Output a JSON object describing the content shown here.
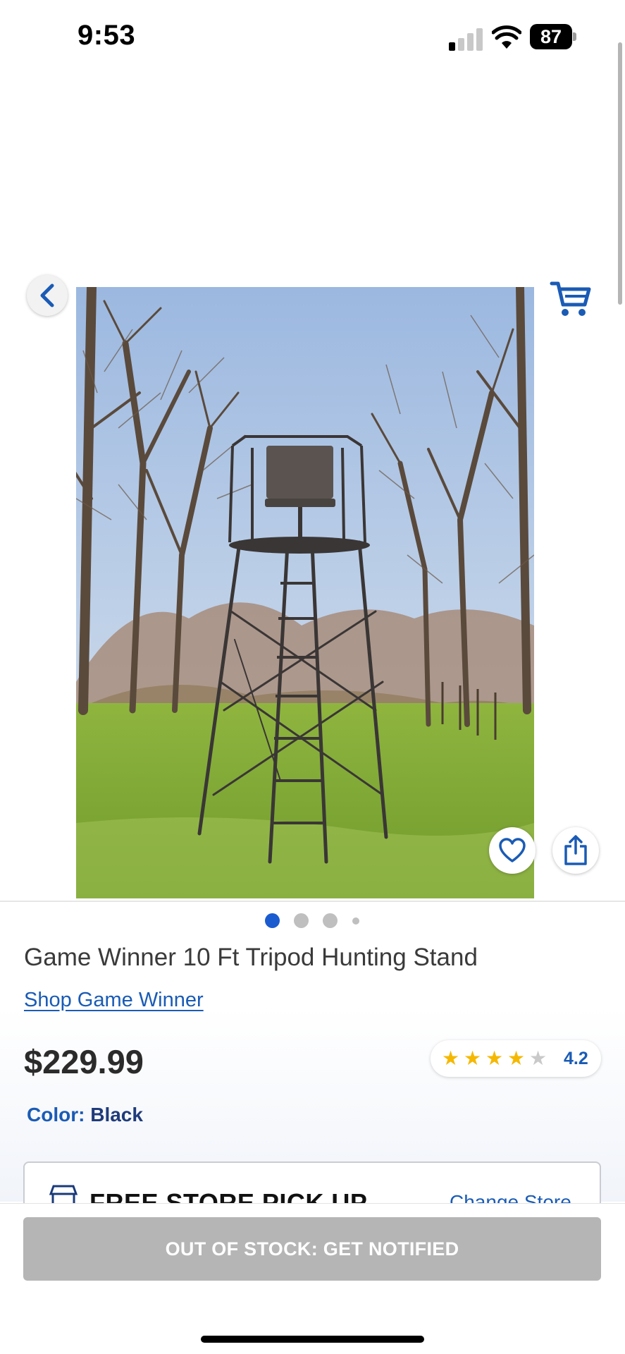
{
  "status_bar": {
    "time": "9:53",
    "battery": "87",
    "icons": [
      "signal-icon",
      "wifi-icon",
      "battery-icon"
    ]
  },
  "header": {
    "icons": [
      "chevron-left-icon",
      "cart-icon"
    ]
  },
  "gallery": {
    "image_count": 4,
    "active_index": 0,
    "actions": [
      "heart-icon",
      "share-icon"
    ]
  },
  "product": {
    "title": "Game Winner 10 Ft Tripod Hunting Stand",
    "brand_link": "Shop Game Winner",
    "price": "$229.99",
    "rating": "4.2",
    "rating_stars": 4.2,
    "color_label": "Color:",
    "color_value": "Black"
  },
  "pickup": {
    "title": "FREE STORE PICK UP",
    "change_store": "Change Store"
  },
  "cta": {
    "label": "OUT OF STOCK: GET NOTIFIED"
  },
  "colors": {
    "brand_blue": "#1a5bb5",
    "star_gold": "#f5b800",
    "star_empty": "#c9c9c9",
    "disabled_button": "#b5b5b5",
    "active_dot": "#1a5bd0",
    "inactive_dot": "#bfbfbf"
  }
}
